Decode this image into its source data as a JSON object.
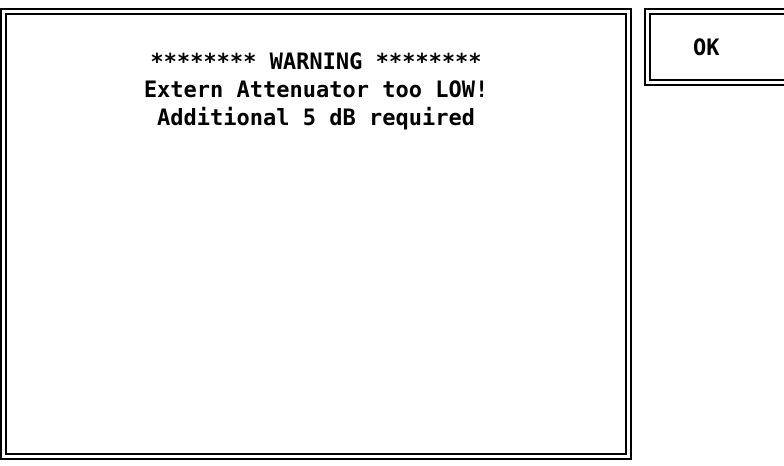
{
  "dialog": {
    "lines": [
      "******** WARNING ********",
      "Extern Attenuator too LOW!",
      "Additional 5 dB required"
    ],
    "ok_label": "OK"
  }
}
